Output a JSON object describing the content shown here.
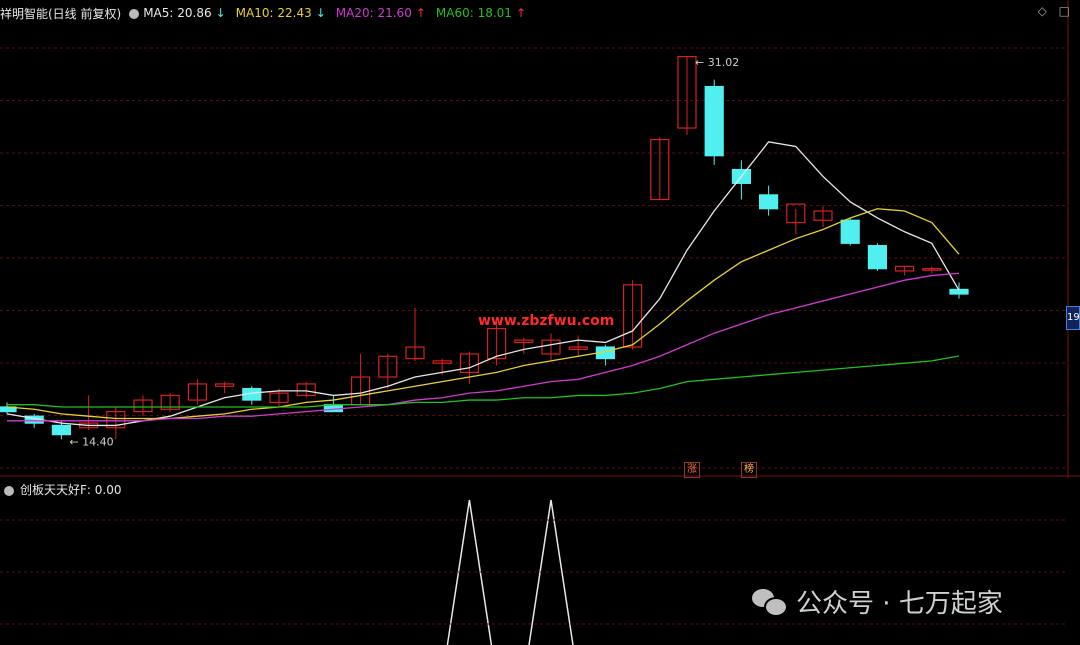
{
  "legend": {
    "title": "祥明智能(日线 前复权)",
    "ma5": "MA5: 20.86",
    "ma5_arrow": "↓",
    "ma10": "MA10: 22.43",
    "ma10_arrow": "↓",
    "ma20": "MA20: 21.60",
    "ma20_arrow": "↑",
    "ma60": "MA60: 18.01",
    "ma60_arrow": "↑",
    "colors": {
      "ma5": "#e8e8e8",
      "ma10": "#e8d030",
      "ma20": "#d03ad0",
      "ma60": "#22c022",
      "up": "#d82020",
      "down": "#50f0f0"
    }
  },
  "corner_icons": {
    "diamond": "◇",
    "square": "□"
  },
  "right_tag": "19",
  "overlay_text": "www.zbzfwu.com",
  "badges": [
    "涨",
    "榜"
  ],
  "sub_legend": {
    "name": "创板天天好F",
    "value": ": 0.00"
  },
  "watermark": {
    "text": "公众号 · 七万起家"
  },
  "chart_data": {
    "type": "candlestick",
    "ylim": [
      13.5,
      32.5
    ],
    "annotations": [
      {
        "label": "31.02",
        "index": 25,
        "value": 31.02
      },
      {
        "label": "14.40",
        "index": 2,
        "value": 14.4
      }
    ],
    "candles": [
      {
        "o": 15.8,
        "h": 16.0,
        "l": 15.5,
        "c": 15.6
      },
      {
        "o": 15.4,
        "h": 15.5,
        "l": 14.9,
        "c": 15.1
      },
      {
        "o": 15.0,
        "h": 15.2,
        "l": 14.4,
        "c": 14.6
      },
      {
        "o": 14.9,
        "h": 16.3,
        "l": 14.8,
        "c": 15.1
      },
      {
        "o": 14.9,
        "h": 15.8,
        "l": 14.4,
        "c": 15.6
      },
      {
        "o": 15.6,
        "h": 16.3,
        "l": 15.4,
        "c": 16.1
      },
      {
        "o": 15.7,
        "h": 16.4,
        "l": 15.6,
        "c": 16.3
      },
      {
        "o": 16.1,
        "h": 17.0,
        "l": 15.9,
        "c": 16.8
      },
      {
        "o": 16.7,
        "h": 16.9,
        "l": 16.4,
        "c": 16.8
      },
      {
        "o": 16.6,
        "h": 16.7,
        "l": 15.9,
        "c": 16.1
      },
      {
        "o": 16.0,
        "h": 16.6,
        "l": 15.8,
        "c": 16.4
      },
      {
        "o": 16.3,
        "h": 16.9,
        "l": 16.2,
        "c": 16.8
      },
      {
        "o": 15.9,
        "h": 16.3,
        "l": 15.8,
        "c": 15.6
      },
      {
        "o": 15.9,
        "h": 18.1,
        "l": 15.9,
        "c": 17.1
      },
      {
        "o": 17.1,
        "h": 18.1,
        "l": 16.6,
        "c": 18.0
      },
      {
        "o": 17.9,
        "h": 20.1,
        "l": 17.8,
        "c": 18.4
      },
      {
        "o": 17.7,
        "h": 17.9,
        "l": 17.2,
        "c": 17.8
      },
      {
        "o": 17.3,
        "h": 18.2,
        "l": 16.8,
        "c": 18.1
      },
      {
        "o": 17.9,
        "h": 19.5,
        "l": 17.6,
        "c": 19.2
      },
      {
        "o": 18.6,
        "h": 18.8,
        "l": 18.1,
        "c": 18.7
      },
      {
        "o": 18.1,
        "h": 19.0,
        "l": 17.8,
        "c": 18.7
      },
      {
        "o": 18.3,
        "h": 18.9,
        "l": 18.0,
        "c": 18.4
      },
      {
        "o": 18.4,
        "h": 18.5,
        "l": 17.6,
        "c": 17.9
      },
      {
        "o": 18.4,
        "h": 21.3,
        "l": 18.3,
        "c": 21.1
      },
      {
        "o": 24.8,
        "h": 27.5,
        "l": 24.8,
        "c": 27.4
      },
      {
        "o": 27.9,
        "h": 31.02,
        "l": 27.6,
        "c": 31.0
      },
      {
        "o": 29.7,
        "h": 30.0,
        "l": 26.3,
        "c": 26.7
      },
      {
        "o": 26.1,
        "h": 26.5,
        "l": 24.8,
        "c": 25.5
      },
      {
        "o": 25.0,
        "h": 25.4,
        "l": 24.1,
        "c": 24.4
      },
      {
        "o": 23.8,
        "h": 24.4,
        "l": 23.3,
        "c": 24.6
      },
      {
        "o": 23.9,
        "h": 24.5,
        "l": 23.6,
        "c": 24.3
      },
      {
        "o": 23.9,
        "h": 24.0,
        "l": 22.8,
        "c": 22.9
      },
      {
        "o": 22.8,
        "h": 22.9,
        "l": 21.7,
        "c": 21.8
      },
      {
        "o": 21.7,
        "h": 21.9,
        "l": 21.5,
        "c": 21.9
      },
      {
        "o": 21.8,
        "h": 21.9,
        "l": 21.6,
        "c": 21.8
      },
      {
        "o": 20.9,
        "h": 21.2,
        "l": 20.5,
        "c": 20.7
      }
    ],
    "ma_series": [
      {
        "name": "MA5",
        "values": [
          15.5,
          15.3,
          15.1,
          15.0,
          15.0,
          15.2,
          15.4,
          15.8,
          16.2,
          16.4,
          16.5,
          16.5,
          16.3,
          16.4,
          16.7,
          17.1,
          17.3,
          17.5,
          18.0,
          18.3,
          18.5,
          18.7,
          18.6,
          19.1,
          20.5,
          22.6,
          24.3,
          25.8,
          27.3,
          27.1,
          25.8,
          24.7,
          24.0,
          23.4,
          22.9,
          20.86
        ]
      },
      {
        "name": "MA10",
        "values": [
          15.8,
          15.7,
          15.5,
          15.4,
          15.3,
          15.3,
          15.3,
          15.4,
          15.5,
          15.7,
          15.8,
          16.0,
          16.1,
          16.3,
          16.5,
          16.7,
          16.9,
          17.1,
          17.3,
          17.6,
          17.8,
          18.0,
          18.2,
          18.5,
          19.4,
          20.4,
          21.3,
          22.1,
          22.6,
          23.1,
          23.5,
          24.0,
          24.4,
          24.3,
          23.8,
          22.43
        ]
      },
      {
        "name": "MA20",
        "values": [
          15.2,
          15.2,
          15.2,
          15.2,
          15.2,
          15.2,
          15.3,
          15.3,
          15.4,
          15.4,
          15.5,
          15.6,
          15.7,
          15.8,
          15.9,
          16.1,
          16.2,
          16.4,
          16.5,
          16.7,
          16.9,
          17.0,
          17.3,
          17.6,
          18.0,
          18.5,
          19.0,
          19.4,
          19.8,
          20.1,
          20.4,
          20.7,
          21.0,
          21.3,
          21.5,
          21.6
        ]
      },
      {
        "name": "MA60",
        "values": [
          15.9,
          15.9,
          15.8,
          15.8,
          15.8,
          15.8,
          15.8,
          15.8,
          15.8,
          15.8,
          15.8,
          15.8,
          15.9,
          15.9,
          15.9,
          16.0,
          16.0,
          16.1,
          16.1,
          16.2,
          16.2,
          16.3,
          16.3,
          16.4,
          16.6,
          16.9,
          17.0,
          17.1,
          17.2,
          17.3,
          17.4,
          17.5,
          17.6,
          17.7,
          17.8,
          18.01
        ]
      }
    ],
    "sub_indicator": {
      "name": "创板天天好F",
      "values": [
        0,
        0,
        0,
        0,
        0,
        0,
        0,
        0,
        0,
        0,
        0,
        0,
        0,
        0,
        0,
        0,
        0,
        0,
        0,
        0,
        0,
        0,
        0,
        0,
        0,
        0,
        0,
        0,
        0,
        0,
        0,
        0,
        0,
        0,
        0,
        0
      ],
      "peaks": [
        {
          "index": 17,
          "value": 1
        },
        {
          "index": 20,
          "value": 1
        }
      ]
    }
  }
}
